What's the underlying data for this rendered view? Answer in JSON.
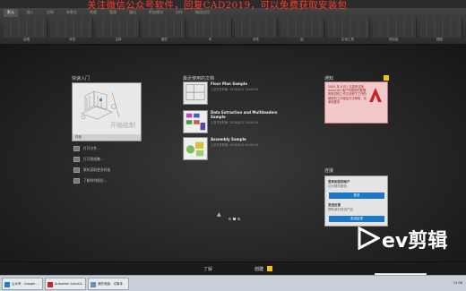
{
  "watermark": "关注微信公众号软件，回复CAD2019，可以免费获取安装包",
  "ribbon": {
    "tabs": [
      "默认",
      "插入",
      "注释",
      "参数化",
      "视图",
      "管理",
      "输出",
      "附加模块",
      "协作",
      "精选应用"
    ],
    "panel_titles": [
      "绘图",
      "修改",
      "注释",
      "图层",
      "块",
      "特性",
      "组",
      "实用工具",
      "剪贴板",
      "视图"
    ]
  },
  "start": {
    "heading": "快速入门",
    "preview_caption": "开始绘制",
    "preview_footer": "样板",
    "links": [
      "打开文件...",
      "打开图纸集...",
      "联机获取更多样板",
      "了解样例图形..."
    ]
  },
  "recent": {
    "heading": "最近使用的文档",
    "items": [
      {
        "title": "Floor Plan Sample",
        "time": "上次打开时间: 2019/6/12 16:09:16"
      },
      {
        "title": "Data Extraction and Multileaders Sample",
        "time": "上次打开时间: 2019/6/12 16:09:16"
      },
      {
        "title": "Assembly Sample",
        "time": "上次打开时间: 2019/6/12 16:09:16"
      }
    ]
  },
  "notices": {
    "heading": "通知",
    "text": "2005 年 8 月1 日发布试用 AutoCAD 用户所提供的数据所提供的工作方法和下工作的使用的工作增加方法帮助，请参阅更多",
    "link": "请参阅更多"
  },
  "connect": {
    "heading": "连接",
    "signin_title": "登录到您的帐户",
    "signin_sub": "访问联机服务",
    "signin_button": "登录",
    "feedback_title": "发送反馈",
    "feedback_sub": "帮助我们改进产品",
    "feedback_button": "发送反馈"
  },
  "bottom_tabs": {
    "learn": "了解",
    "create": "创建"
  },
  "taskbar": {
    "items": [
      "公众号 - Google ...",
      "Autodesk AutoCA...",
      "我的电脑 - 记事本"
    ],
    "tray": "11:06"
  },
  "overlay": {
    "brand": "ev剪辑"
  },
  "colors": {
    "accent": "#1b78c8",
    "badge": "#f5c400",
    "notice_bg": "#f2c9c9",
    "watermark": "#ff3b2f"
  }
}
